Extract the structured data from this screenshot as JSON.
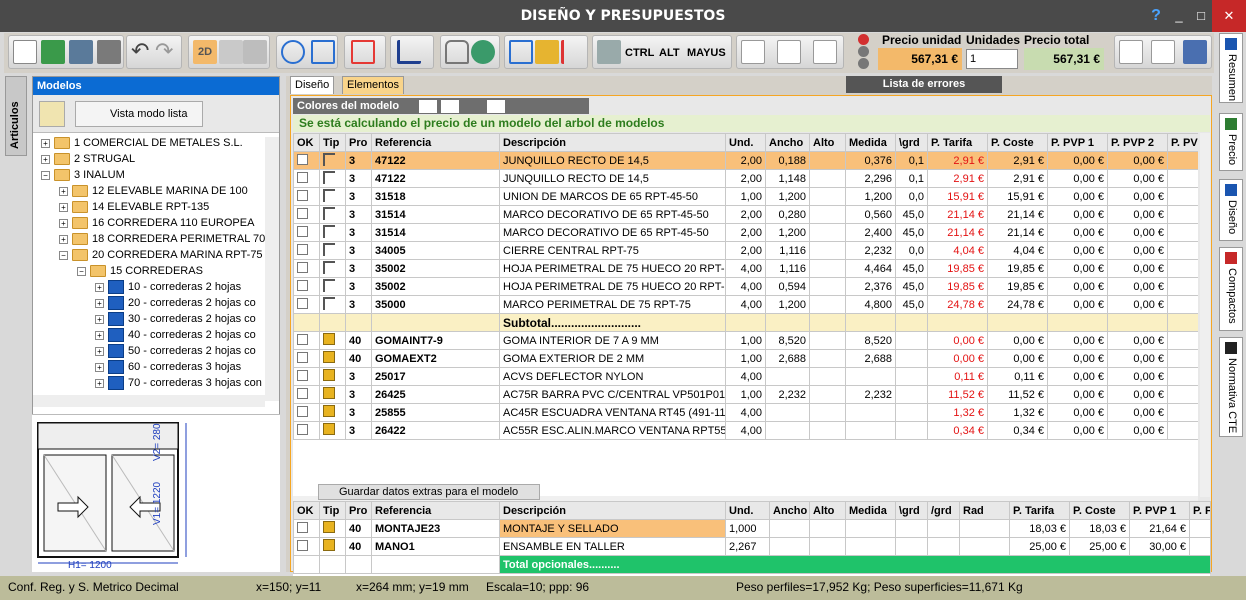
{
  "window": {
    "title": "DISEÑO Y PRESUPUESTOS"
  },
  "toolbar": {
    "ctrl": "CTRL",
    "alt": "ALT",
    "mayus": "MAYUS",
    "view2d": "2D",
    "precio_unidad_label": "Precio unidad",
    "precio_unidad": "567,31 €",
    "unidades_label": "Unidades",
    "unidades": "1",
    "precio_total_label": "Precio total",
    "precio_total": "567,31 €"
  },
  "left_tab": "Articulos",
  "models": {
    "title": "Modelos",
    "list_mode": "Vista modo lista",
    "tree": [
      {
        "label": "1 COMERCIAL DE METALES S.L.",
        "level": 0,
        "kind": "folder"
      },
      {
        "label": "2 STRUGAL",
        "level": 0,
        "kind": "folder"
      },
      {
        "label": "3 INALUM",
        "level": 0,
        "kind": "folder"
      },
      {
        "label": "12 ELEVABLE MARINA DE 100",
        "level": 1,
        "kind": "folder"
      },
      {
        "label": "14 ELEVABLE RPT-135",
        "level": 1,
        "kind": "folder"
      },
      {
        "label": "16 CORREDERA 110 EUROPEA",
        "level": 1,
        "kind": "folder"
      },
      {
        "label": "18 CORREDERA PERIMETRAL 70",
        "level": 1,
        "kind": "folder"
      },
      {
        "label": "20 CORREDERA MARINA RPT-75",
        "level": 1,
        "kind": "folder"
      },
      {
        "label": "15 CORREDERAS",
        "level": 2,
        "kind": "folder"
      },
      {
        "label": "10 - correderas 2 hojas",
        "level": 3,
        "kind": "window"
      },
      {
        "label": "20 - correderas 2 hojas co",
        "level": 3,
        "kind": "window"
      },
      {
        "label": "30 - correderas 2 hojas co",
        "level": 3,
        "kind": "window"
      },
      {
        "label": "40 - correderas 2 hojas co",
        "level": 3,
        "kind": "window"
      },
      {
        "label": "50 - correderas 2 hojas co",
        "level": 3,
        "kind": "window"
      },
      {
        "label": "60 - correderas 3 hojas",
        "level": 3,
        "kind": "window"
      },
      {
        "label": "70 - correderas 3 hojas con",
        "level": 3,
        "kind": "window"
      }
    ],
    "preview": {
      "h1": "H1= 1200",
      "v1": "V1= 1220",
      "v2": "V2= 280"
    }
  },
  "tabs": {
    "diseno": "Diseño",
    "elementos": "Elementos",
    "errores": "Lista de errores"
  },
  "colores_label": "Colores del modelo",
  "message": "Se está calculando el precio de un modelo del arbol de modelos",
  "grid1": {
    "headers": [
      "OK",
      "Tip",
      "Pro",
      "Referencia",
      "Descripción",
      "Und.",
      "Ancho",
      "Alto",
      "Medida",
      "\\grd",
      "P. Tarifa",
      "P. Coste",
      "P. PVP 1",
      "P. PVP 2",
      "P. PV"
    ],
    "rows": [
      {
        "tip": "profile",
        "pro": "3",
        "ref": "47122",
        "desc": "JUNQUILLO RECTO DE 14,5",
        "und": "2,00",
        "ancho": "0,188",
        "alto": "",
        "medida": "0,376",
        "grd": "0,1",
        "tarifa": "2,91 €",
        "coste": "2,91 €",
        "pvp1": "0,00 €",
        "pvp2": "0,00 €",
        "hl": true
      },
      {
        "tip": "profile",
        "pro": "3",
        "ref": "47122",
        "desc": "JUNQUILLO RECTO DE 14,5",
        "und": "2,00",
        "ancho": "1,148",
        "alto": "",
        "medida": "2,296",
        "grd": "0,1",
        "tarifa": "2,91 €",
        "coste": "2,91 €",
        "pvp1": "0,00 €",
        "pvp2": "0,00 €"
      },
      {
        "tip": "profile",
        "pro": "3",
        "ref": "31518",
        "desc": "UNION DE MARCOS DE 65 RPT-45-50",
        "und": "1,00",
        "ancho": "1,200",
        "alto": "",
        "medida": "1,200",
        "grd": "0,0",
        "tarifa": "15,91 €",
        "coste": "15,91 €",
        "pvp1": "0,00 €",
        "pvp2": "0,00 €"
      },
      {
        "tip": "profile",
        "pro": "3",
        "ref": "31514",
        "desc": "MARCO DECORATIVO DE 65 RPT-45-50",
        "und": "2,00",
        "ancho": "0,280",
        "alto": "",
        "medida": "0,560",
        "grd": "45,0",
        "tarifa": "21,14 €",
        "coste": "21,14 €",
        "pvp1": "0,00 €",
        "pvp2": "0,00 €"
      },
      {
        "tip": "profile",
        "pro": "3",
        "ref": "31514",
        "desc": "MARCO DECORATIVO DE 65 RPT-45-50",
        "und": "2,00",
        "ancho": "1,200",
        "alto": "",
        "medida": "2,400",
        "grd": "45,0",
        "tarifa": "21,14 €",
        "coste": "21,14 €",
        "pvp1": "0,00 €",
        "pvp2": "0,00 €"
      },
      {
        "tip": "profile",
        "pro": "3",
        "ref": "34005",
        "desc": "CIERRE CENTRAL RPT-75",
        "und": "2,00",
        "ancho": "1,116",
        "alto": "",
        "medida": "2,232",
        "grd": "0,0",
        "tarifa": "4,04 €",
        "coste": "4,04 €",
        "pvp1": "0,00 €",
        "pvp2": "0,00 €"
      },
      {
        "tip": "profile",
        "pro": "3",
        "ref": "35002",
        "desc": "HOJA PERIMETRAL DE 75 HUECO 20 RPT-75",
        "und": "4,00",
        "ancho": "1,116",
        "alto": "",
        "medida": "4,464",
        "grd": "45,0",
        "tarifa": "19,85 €",
        "coste": "19,85 €",
        "pvp1": "0,00 €",
        "pvp2": "0,00 €"
      },
      {
        "tip": "profile",
        "pro": "3",
        "ref": "35002",
        "desc": "HOJA PERIMETRAL DE 75 HUECO 20 RPT-75",
        "und": "4,00",
        "ancho": "0,594",
        "alto": "",
        "medida": "2,376",
        "grd": "45,0",
        "tarifa": "19,85 €",
        "coste": "19,85 €",
        "pvp1": "0,00 €",
        "pvp2": "0,00 €"
      },
      {
        "tip": "profile",
        "pro": "3",
        "ref": "35000",
        "desc": "MARCO PERIMETRAL DE 75 RPT-75",
        "und": "4,00",
        "ancho": "1,200",
        "alto": "",
        "medida": "4,800",
        "grd": "45,0",
        "tarifa": "24,78 €",
        "coste": "24,78 €",
        "pvp1": "0,00 €",
        "pvp2": "0,00 €"
      },
      {
        "subtotal": "Subtotal..........................."
      },
      {
        "tip": "acc",
        "pro": "40",
        "ref": "GOMAINT7-9",
        "desc": "GOMA INTERIOR DE 7 A 9 MM",
        "und": "1,00",
        "ancho": "8,520",
        "alto": "",
        "medida": "8,520",
        "grd": "",
        "tarifa": "0,00 €",
        "coste": "0,00 €",
        "pvp1": "0,00 €",
        "pvp2": "0,00 €"
      },
      {
        "tip": "acc",
        "pro": "40",
        "ref": "GOMAEXT2",
        "desc": "GOMA EXTERIOR DE 2 MM",
        "und": "1,00",
        "ancho": "2,688",
        "alto": "",
        "medida": "2,688",
        "grd": "",
        "tarifa": "0,00 €",
        "coste": "0,00 €",
        "pvp1": "0,00 €",
        "pvp2": "0,00 €"
      },
      {
        "tip": "acc",
        "pro": "3",
        "ref": "25017",
        "desc": "ACVS DEFLECTOR NYLON",
        "und": "4,00",
        "ancho": "",
        "alto": "",
        "medida": "",
        "grd": "",
        "tarifa": "0,11 €",
        "coste": "0,11 €",
        "pvp1": "0,00 €",
        "pvp2": "0,00 €"
      },
      {
        "tip": "acc",
        "pro": "3",
        "ref": "26425",
        "desc": "AC75R BARRA PVC C/CENTRAL VP501P01E01",
        "und": "1,00",
        "ancho": "2,232",
        "alto": "",
        "medida": "2,232",
        "grd": "",
        "tarifa": "11,52 €",
        "coste": "11,52 €",
        "pvp1": "0,00 €",
        "pvp2": "0,00 €"
      },
      {
        "tip": "acc",
        "pro": "3",
        "ref": "25855",
        "desc": "AC45R ESCUADRA VENTANA RT45 (491-1143)",
        "und": "4,00",
        "ancho": "",
        "alto": "",
        "medida": "",
        "grd": "",
        "tarifa": "1,32 €",
        "coste": "1,32 €",
        "pvp1": "0,00 €",
        "pvp2": "0,00 €"
      },
      {
        "tip": "acc",
        "pro": "3",
        "ref": "26422",
        "desc": "AC55R ESC.ALIN.MARCO VENTANA RPT55-60.",
        "und": "4,00",
        "ancho": "",
        "alto": "",
        "medida": "",
        "grd": "",
        "tarifa": "0,34 €",
        "coste": "0,34 €",
        "pvp1": "0,00 €",
        "pvp2": "0,00 €"
      }
    ]
  },
  "save_extras": "Guardar datos extras para el modelo",
  "grid2": {
    "headers": [
      "OK",
      "Tip",
      "Pro",
      "Referencia",
      "Descripción",
      "Und.",
      "Ancho",
      "Alto",
      "Medida",
      "\\grd",
      "/grd",
      "Rad",
      "P. Tarifa",
      "P. Coste",
      "P. PVP 1",
      "P. P"
    ],
    "rows": [
      {
        "pro": "40",
        "ref": "MONTAJE23",
        "desc": "MONTAJE Y SELLADO",
        "und": "1,000",
        "tarifa": "18,03 €",
        "coste": "18,03 €",
        "pvp1": "21,64 €",
        "hl": true
      },
      {
        "pro": "40",
        "ref": "MANO1",
        "desc": "ENSAMBLE EN TALLER",
        "und": "2,267",
        "tarifa": "25,00 €",
        "coste": "25,00 €",
        "pvp1": "30,00 €"
      }
    ],
    "total": "Total opcionales.........."
  },
  "right_tabs": [
    "Resumen",
    "Precio",
    "Diseño",
    "Compactos",
    "Normativa CTE"
  ],
  "status": {
    "conf": "Conf. Reg. y S. Metrico Decimal",
    "xy": "x=150; y=11",
    "mm": "x=264 mm; y=19 mm",
    "escala": "Escala=10; ppp: 96",
    "peso": "Peso perfiles=17,952 Kg; Peso superficies=11,671 Kg"
  }
}
